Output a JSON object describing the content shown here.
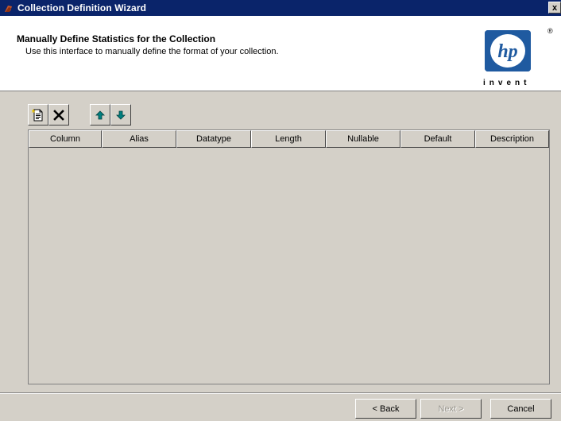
{
  "window": {
    "title": "Collection Definition Wizard",
    "close_label": "x"
  },
  "header": {
    "title": "Manually Define Statistics for the Collection",
    "subtitle": "Use this interface to manually define the format of your collection.",
    "logo": {
      "brand": "hp",
      "tagline": "invent",
      "registered": "®",
      "color": "#1f5aa0"
    }
  },
  "toolbar": {
    "buttons": [
      {
        "name": "new-row",
        "icon": "new-document-icon"
      },
      {
        "name": "delete-row",
        "icon": "delete-x-icon"
      },
      {
        "name": "move-up",
        "icon": "arrow-up-icon"
      },
      {
        "name": "move-down",
        "icon": "arrow-down-icon"
      }
    ]
  },
  "table": {
    "columns": [
      "Column",
      "Alias",
      "Datatype",
      "Length",
      "Nullable",
      "Default",
      "Description"
    ],
    "rows": []
  },
  "footer": {
    "back_label": "< Back",
    "next_label": "Next >",
    "cancel_label": "Cancel",
    "next_enabled": false
  },
  "colors": {
    "title_bar": "#0a246a",
    "dialog_face": "#d4d0c8",
    "arrow_accent": "#008080"
  }
}
